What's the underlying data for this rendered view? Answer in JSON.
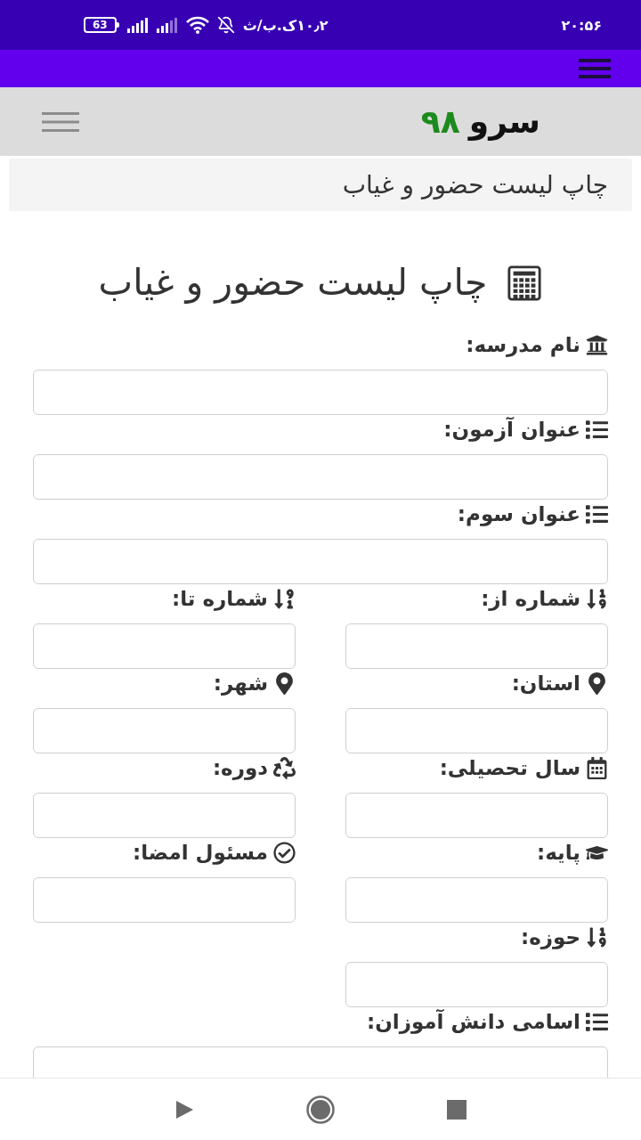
{
  "status_bar": {
    "time": "۲۰:۵۶",
    "network_speed": "۱۰٫۲ک.ب/ث",
    "battery": "63"
  },
  "header": {
    "logo_name": "سرو",
    "logo_number": "۹۸"
  },
  "breadcrumb": "چاپ لیست حضور و غیاب",
  "form": {
    "title": "چاپ لیست حضور و غیاب",
    "fields": [
      {
        "kind": "wide",
        "label": "نام مدرسه:"
      },
      {
        "kind": "wide",
        "label": "عنوان آزمون:"
      },
      {
        "kind": "wide",
        "label": "عنوان سوم:"
      },
      {
        "kind": "half",
        "label": "شماره از:"
      },
      {
        "kind": "half",
        "label": "شماره تا:"
      },
      {
        "kind": "half",
        "label": "استان:"
      },
      {
        "kind": "half",
        "label": "شهر:"
      },
      {
        "kind": "half",
        "label": "سال تحصیلی:"
      },
      {
        "kind": "half",
        "label": "دوره:"
      },
      {
        "kind": "half",
        "label": "پایه:"
      },
      {
        "kind": "half",
        "label": "مسئول امضا:"
      },
      {
        "kind": "half",
        "label": "حوزه:"
      },
      {
        "kind": "wide",
        "label": "اسامی دانش آموزان:"
      }
    ]
  }
}
